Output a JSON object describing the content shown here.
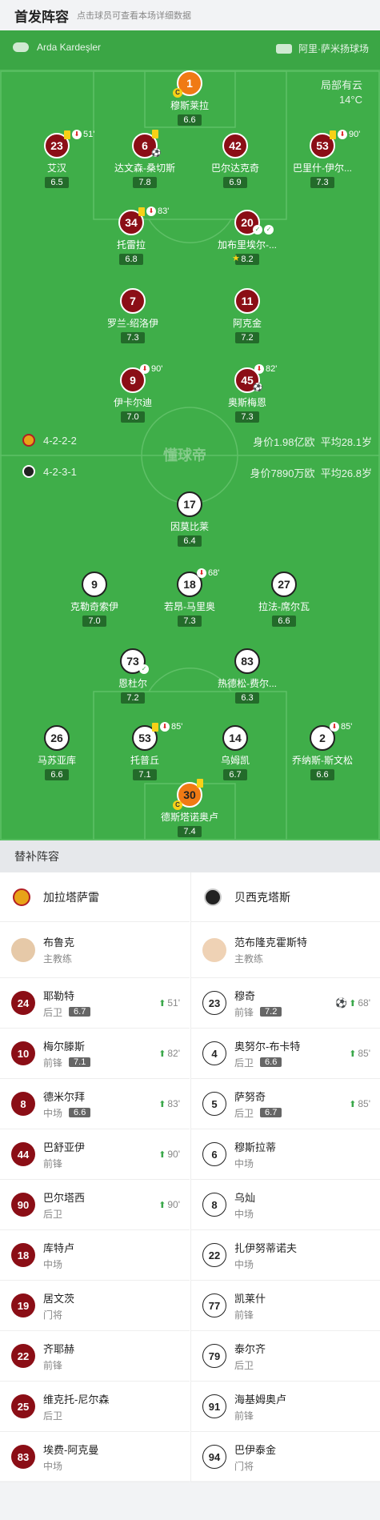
{
  "header": {
    "title": "首发阵容",
    "subtitle": "点击球员可查看本场详细数据"
  },
  "pitch": {
    "coach": "Arda Kardeşler",
    "venue": "阿里·萨米扬球场",
    "weather": "局部有云",
    "temp": "14°C",
    "watermark": "懂球帝",
    "home": {
      "formation": "4-2-2-2",
      "value": "身价1.98亿欧",
      "age": "平均28.1岁"
    },
    "away": {
      "formation": "4-2-3-1",
      "value": "身价7890万欧",
      "age": "平均26.8岁"
    },
    "players": [
      {
        "num": "1",
        "name": "穆斯莱拉",
        "rating": "6.6",
        "cls": "gk1"
      },
      {
        "num": "23",
        "name": "艾汉",
        "rating": "6.5",
        "cls": "red",
        "sub": "51'"
      },
      {
        "num": "6",
        "name": "达文森-桑切斯",
        "rating": "7.8",
        "cls": "red"
      },
      {
        "num": "42",
        "name": "巴尔达克奇",
        "rating": "6.9",
        "cls": "red"
      },
      {
        "num": "53",
        "name": "巴里什-伊尔...",
        "rating": "7.3",
        "cls": "red",
        "sub": "90'"
      },
      {
        "num": "34",
        "name": "托雷拉",
        "rating": "6.8",
        "cls": "red",
        "sub": "83'"
      },
      {
        "num": "20",
        "name": "加布里埃尔-...",
        "rating": "8.2",
        "cls": "red"
      },
      {
        "num": "7",
        "name": "罗兰-绍洛伊",
        "rating": "7.3",
        "cls": "red"
      },
      {
        "num": "11",
        "name": "阿克金",
        "rating": "7.2",
        "cls": "red"
      },
      {
        "num": "9",
        "name": "伊卡尔迪",
        "rating": "7.0",
        "cls": "red",
        "sub": "90'"
      },
      {
        "num": "45",
        "name": "奥斯梅恩",
        "rating": "7.3",
        "cls": "red",
        "sub": "82'"
      },
      {
        "num": "17",
        "name": "因莫比莱",
        "rating": "6.4",
        "cls": "wht"
      },
      {
        "num": "9",
        "name": "克勒奇索伊",
        "rating": "7.0",
        "cls": "wht"
      },
      {
        "num": "18",
        "name": "若昂-马里奥",
        "rating": "7.3",
        "cls": "wht",
        "sub": "68'"
      },
      {
        "num": "27",
        "name": "拉法-席尔瓦",
        "rating": "6.6",
        "cls": "wht"
      },
      {
        "num": "73",
        "name": "恩杜尔",
        "rating": "7.2",
        "cls": "wht"
      },
      {
        "num": "83",
        "name": "热德松-费尔...",
        "rating": "6.3",
        "cls": "wht"
      },
      {
        "num": "26",
        "name": "马苏亚库",
        "rating": "6.6",
        "cls": "wht"
      },
      {
        "num": "53",
        "name": "托普丘",
        "rating": "7.1",
        "cls": "wht",
        "sub": "85'"
      },
      {
        "num": "14",
        "name": "乌姆凯",
        "rating": "6.7",
        "cls": "wht"
      },
      {
        "num": "2",
        "name": "乔纳斯-斯文松",
        "rating": "6.6",
        "cls": "wht",
        "sub": "85'"
      },
      {
        "num": "30",
        "name": "德斯塔诺奥卢",
        "rating": "7.4",
        "cls": "gk2"
      }
    ],
    "captain": "C"
  },
  "subs": {
    "title": "替补阵容",
    "home": {
      "team": "加拉塔萨雷",
      "coach": "布鲁克",
      "coach_role": "主教练",
      "list": [
        {
          "num": "24",
          "name": "耶勒特",
          "pos": "后卫",
          "rating": "6.7",
          "time": "51'"
        },
        {
          "num": "10",
          "name": "梅尔滕斯",
          "pos": "前锋",
          "rating": "7.1",
          "time": "82'"
        },
        {
          "num": "8",
          "name": "德米尔拜",
          "pos": "中场",
          "rating": "6.6",
          "time": "83'"
        },
        {
          "num": "44",
          "name": "巴舒亚伊",
          "pos": "前锋",
          "rating": "",
          "time": "90'"
        },
        {
          "num": "90",
          "name": "巴尔塔西",
          "pos": "后卫",
          "rating": "",
          "time": "90'"
        },
        {
          "num": "18",
          "name": "库特卢",
          "pos": "中场",
          "rating": "",
          "time": ""
        },
        {
          "num": "19",
          "name": "居文茨",
          "pos": "门将",
          "rating": "",
          "time": ""
        },
        {
          "num": "22",
          "name": "齐耶赫",
          "pos": "前锋",
          "rating": "",
          "time": ""
        },
        {
          "num": "25",
          "name": "维克托-尼尔森",
          "pos": "后卫",
          "rating": "",
          "time": ""
        },
        {
          "num": "83",
          "name": "埃费-阿克曼",
          "pos": "中场",
          "rating": "",
          "time": ""
        }
      ]
    },
    "away": {
      "team": "贝西克塔斯",
      "coach": "范布隆克霍斯特",
      "coach_role": "主教练",
      "list": [
        {
          "num": "23",
          "name": "穆奇",
          "pos": "前锋",
          "rating": "7.2",
          "time": "68'"
        },
        {
          "num": "4",
          "name": "奥努尔-布卡特",
          "pos": "后卫",
          "rating": "6.6",
          "time": "85'"
        },
        {
          "num": "5",
          "name": "萨努奇",
          "pos": "后卫",
          "rating": "6.7",
          "time": "85'"
        },
        {
          "num": "6",
          "name": "穆斯拉蒂",
          "pos": "中场",
          "rating": "",
          "time": ""
        },
        {
          "num": "8",
          "name": "乌灿",
          "pos": "中场",
          "rating": "",
          "time": ""
        },
        {
          "num": "22",
          "name": "扎伊努蒂诺夫",
          "pos": "中场",
          "rating": "",
          "time": ""
        },
        {
          "num": "77",
          "name": "凯莱什",
          "pos": "前锋",
          "rating": "",
          "time": ""
        },
        {
          "num": "79",
          "name": "泰尔齐",
          "pos": "后卫",
          "rating": "",
          "time": ""
        },
        {
          "num": "91",
          "name": "海基姆奥卢",
          "pos": "前锋",
          "rating": "",
          "time": ""
        },
        {
          "num": "94",
          "name": "巴伊泰金",
          "pos": "门将",
          "rating": "",
          "time": ""
        }
      ]
    }
  },
  "colors": {
    "pitch": "#3fae49",
    "home": "#8b0e16",
    "gk": "#f07a14",
    "card": "#f7d117"
  }
}
